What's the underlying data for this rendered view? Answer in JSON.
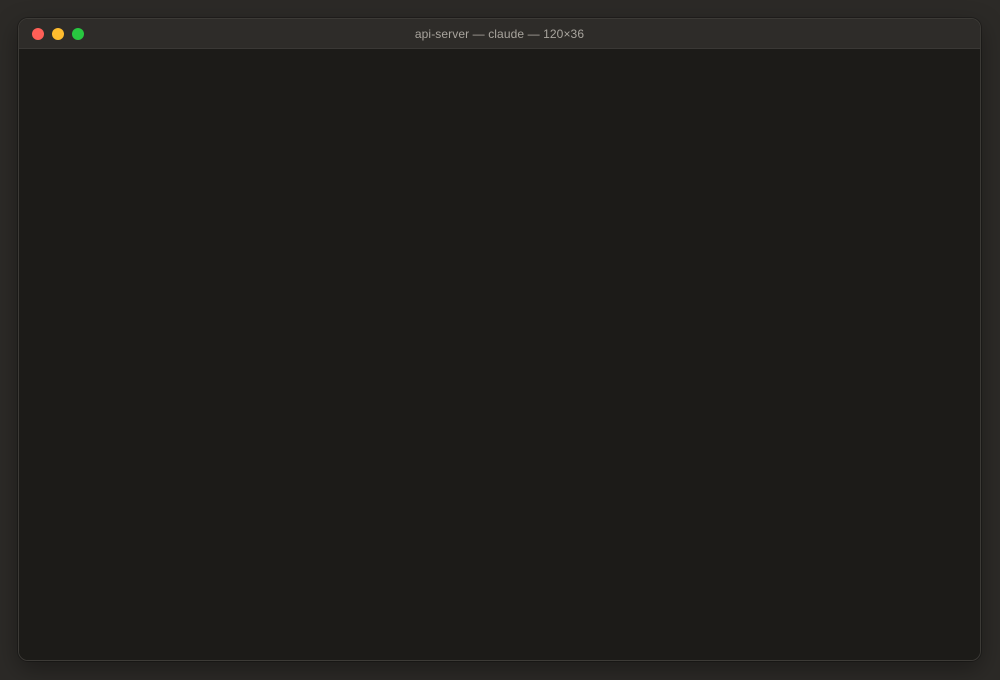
{
  "window": {
    "title": "api-server — claude — 120×36",
    "controls": {
      "close": "close-icon",
      "minimize": "minimize-icon",
      "zoom": "zoom-icon"
    }
  },
  "colors": {
    "desktop": "#2c2a27",
    "titlebar": "#2e2c29",
    "terminal_background": "#1c1b18",
    "title_text": "#a8a49d",
    "close": "#ff5f57",
    "minimize": "#febc2e",
    "zoom": "#28c840"
  },
  "terminal": {
    "content": ""
  }
}
